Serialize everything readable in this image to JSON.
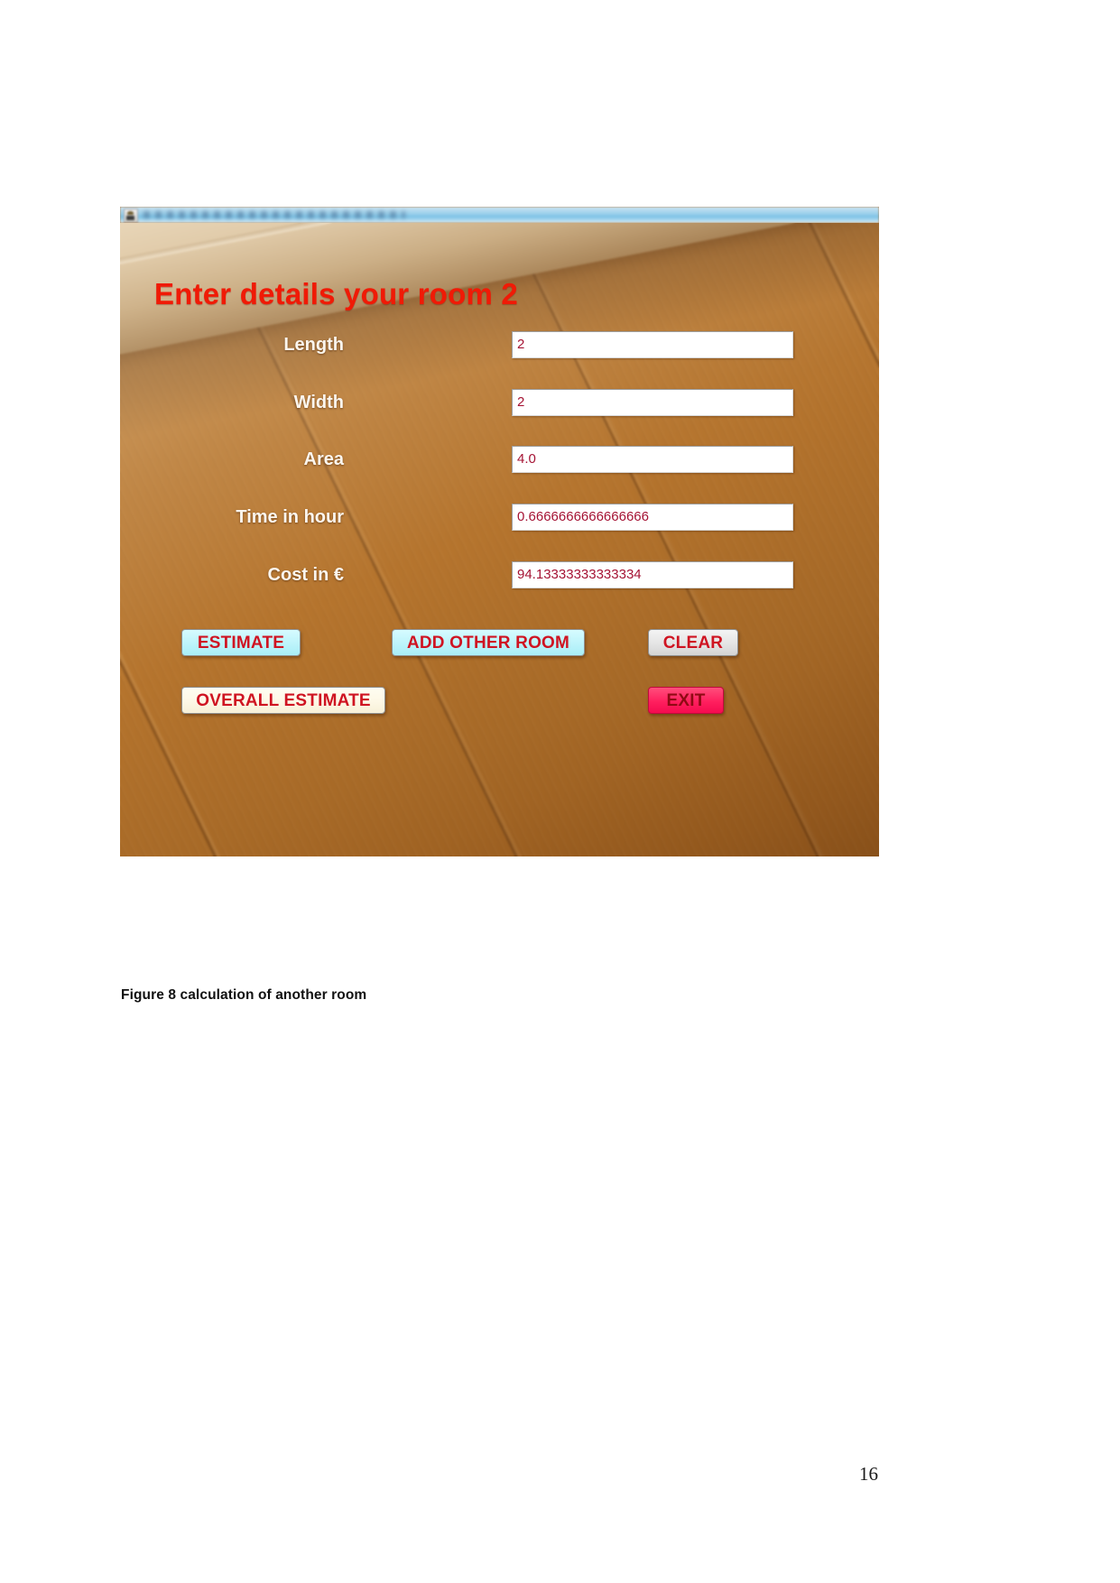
{
  "document": {
    "figure_caption": "Figure 8 calculation of another room",
    "page_number": "16"
  },
  "app_window": {
    "titlebar": {
      "icon": "java-coffee-cup-icon",
      "title": ""
    },
    "form_title": "Enter details your room 2",
    "fields": [
      {
        "label": "Length",
        "value": "2",
        "name": "length"
      },
      {
        "label": "Width",
        "value": "2",
        "name": "width"
      },
      {
        "label": "Area",
        "value": "4.0",
        "name": "area"
      },
      {
        "label": "Time in hour",
        "value": "0.6666666666666666",
        "name": "time-in-hour"
      },
      {
        "label": "Cost in €",
        "value": "94.13333333333334",
        "name": "cost-in-euro"
      }
    ],
    "buttons": [
      {
        "label": "ESTIMATE",
        "style": "cyan",
        "name": "estimate"
      },
      {
        "label": "ADD OTHER ROOM",
        "style": "cyan",
        "name": "add-other-room"
      },
      {
        "label": "CLEAR",
        "style": "gray",
        "name": "clear"
      },
      {
        "label": "OVERALL ESTIMATE",
        "style": "cream",
        "name": "overall-estimate"
      },
      {
        "label": "EXIT",
        "style": "pink",
        "name": "exit"
      }
    ],
    "colors": {
      "title_red": "#f01a06",
      "label_white": "#fbf6ee",
      "value_red": "#a51334",
      "button_text_red": "#cf1422",
      "button_cyan": "#bdf4fb",
      "button_gray": "#e4e4e4",
      "button_cream": "#fdf8e6",
      "button_pink": "#ff1f5e",
      "wood_background": "#b4742f"
    }
  }
}
